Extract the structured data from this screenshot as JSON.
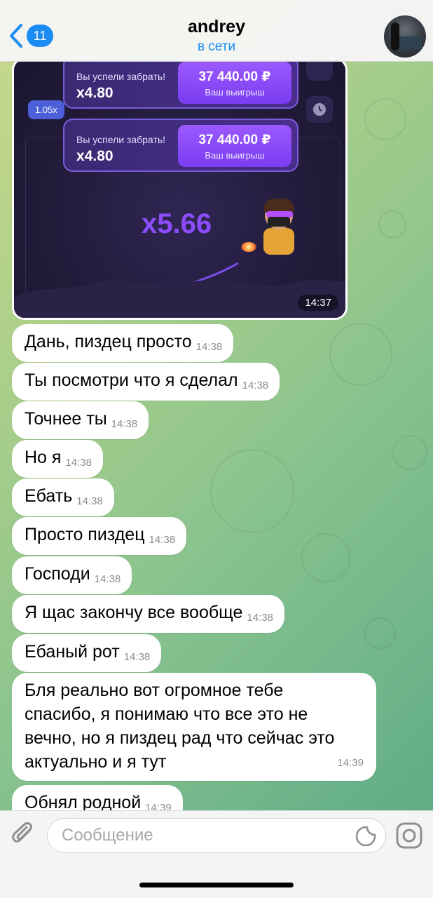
{
  "header": {
    "back_count": "11",
    "contact_name": "andrey",
    "status": "в сети"
  },
  "media": {
    "multiplier_chip": "1.05x",
    "wins": [
      {
        "label": "Вы успели забрать!",
        "multiplier": "x4.80",
        "amount": "37 440.00 ₽",
        "caption": "Ваш выигрыш"
      },
      {
        "label": "Вы успели забрать!",
        "multiplier": "x4.80",
        "amount": "37 440.00 ₽",
        "caption": "Ваш выигрыш"
      }
    ],
    "current_multiplier": "x5.66",
    "time": "14:37"
  },
  "messages": [
    {
      "text": "Дань, пиздец просто",
      "time": "14:38"
    },
    {
      "text": "Ты посмотри что я сделал",
      "time": "14:38"
    },
    {
      "text": "Точнее ты",
      "time": "14:38"
    },
    {
      "text": "Но я",
      "time": "14:38"
    },
    {
      "text": "Ебать",
      "time": "14:38"
    },
    {
      "text": "Просто пиздец",
      "time": "14:38"
    },
    {
      "text": "Господи",
      "time": "14:38"
    },
    {
      "text": "Я щас закончу все вообще",
      "time": "14:38"
    },
    {
      "text": "Ебаный рот",
      "time": "14:38"
    },
    {
      "text": "Бля реально вот огромное тебе спасибо, я понимаю что все это не вечно, но я пиздец рад что сейчас это актуально и я тут",
      "time": "14:39"
    },
    {
      "text": "Обнял родной",
      "time": "14:39"
    }
  ],
  "composer": {
    "placeholder": "Сообщение"
  },
  "colors": {
    "accent": "#1b8cf2",
    "bubble": "#ffffff",
    "game_purple": "#8d4dff"
  }
}
